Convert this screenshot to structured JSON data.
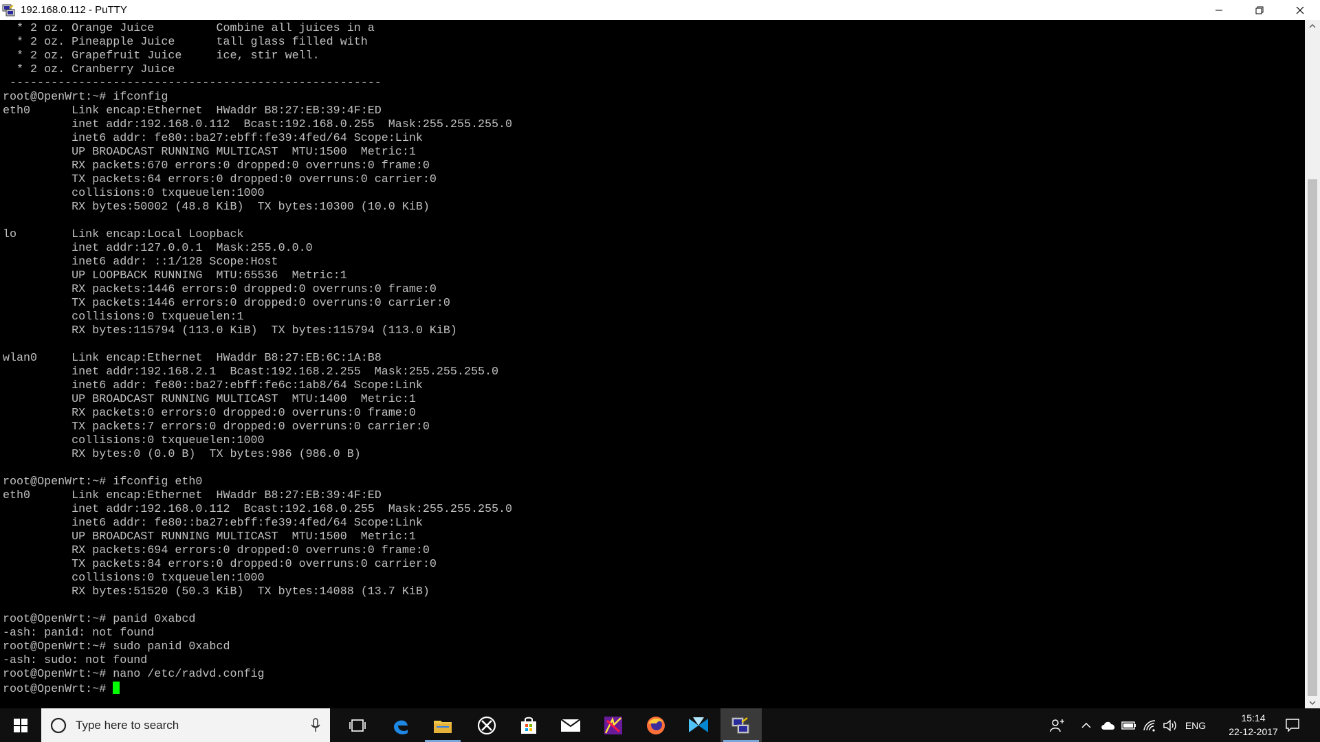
{
  "window": {
    "title": "192.168.0.112 - PuTTY",
    "minimize_icon": "minimize-icon",
    "maximize_icon": "restore-icon",
    "close_icon": "close-icon"
  },
  "terminal": {
    "lines": [
      "  * 2 oz. Orange Juice         Combine all juices in a",
      "  * 2 oz. Pineapple Juice      tall glass filled with",
      "  * 2 oz. Grapefruit Juice     ice, stir well.",
      "  * 2 oz. Cranberry Juice",
      " ------------------------------------------------------",
      "root@OpenWrt:~# ifconfig",
      "eth0      Link encap:Ethernet  HWaddr B8:27:EB:39:4F:ED",
      "          inet addr:192.168.0.112  Bcast:192.168.0.255  Mask:255.255.255.0",
      "          inet6 addr: fe80::ba27:ebff:fe39:4fed/64 Scope:Link",
      "          UP BROADCAST RUNNING MULTICAST  MTU:1500  Metric:1",
      "          RX packets:670 errors:0 dropped:0 overruns:0 frame:0",
      "          TX packets:64 errors:0 dropped:0 overruns:0 carrier:0",
      "          collisions:0 txqueuelen:1000",
      "          RX bytes:50002 (48.8 KiB)  TX bytes:10300 (10.0 KiB)",
      "",
      "lo        Link encap:Local Loopback",
      "          inet addr:127.0.0.1  Mask:255.0.0.0",
      "          inet6 addr: ::1/128 Scope:Host",
      "          UP LOOPBACK RUNNING  MTU:65536  Metric:1",
      "          RX packets:1446 errors:0 dropped:0 overruns:0 frame:0",
      "          TX packets:1446 errors:0 dropped:0 overruns:0 carrier:0",
      "          collisions:0 txqueuelen:1",
      "          RX bytes:115794 (113.0 KiB)  TX bytes:115794 (113.0 KiB)",
      "",
      "wlan0     Link encap:Ethernet  HWaddr B8:27:EB:6C:1A:B8",
      "          inet addr:192.168.2.1  Bcast:192.168.2.255  Mask:255.255.255.0",
      "          inet6 addr: fe80::ba27:ebff:fe6c:1ab8/64 Scope:Link",
      "          UP BROADCAST RUNNING MULTICAST  MTU:1400  Metric:1",
      "          RX packets:0 errors:0 dropped:0 overruns:0 frame:0",
      "          TX packets:7 errors:0 dropped:0 overruns:0 carrier:0",
      "          collisions:0 txqueuelen:1000",
      "          RX bytes:0 (0.0 B)  TX bytes:986 (986.0 B)",
      "",
      "root@OpenWrt:~# ifconfig eth0",
      "eth0      Link encap:Ethernet  HWaddr B8:27:EB:39:4F:ED",
      "          inet addr:192.168.0.112  Bcast:192.168.0.255  Mask:255.255.255.0",
      "          inet6 addr: fe80::ba27:ebff:fe39:4fed/64 Scope:Link",
      "          UP BROADCAST RUNNING MULTICAST  MTU:1500  Metric:1",
      "          RX packets:694 errors:0 dropped:0 overruns:0 frame:0",
      "          TX packets:84 errors:0 dropped:0 overruns:0 carrier:0",
      "          collisions:0 txqueuelen:1000",
      "          RX bytes:51520 (50.3 KiB)  TX bytes:14088 (13.7 KiB)",
      "",
      "root@OpenWrt:~# panid 0xabcd",
      "-ash: panid: not found",
      "root@OpenWrt:~# sudo panid 0xabcd",
      "-ash: sudo: not found",
      "root@OpenWrt:~# nano /etc/radvd.config"
    ],
    "prompt": "root@OpenWrt:~# ",
    "cursor_color": "#00ff00",
    "text_color": "#c0c0c0"
  },
  "taskbar": {
    "search_placeholder": "Type here to search",
    "apps": [
      {
        "name": "task-view-icon"
      },
      {
        "name": "edge-icon"
      },
      {
        "name": "file-explorer-icon"
      },
      {
        "name": "xbox-icon"
      },
      {
        "name": "store-icon"
      },
      {
        "name": "mail-icon"
      },
      {
        "name": "app-icon"
      },
      {
        "name": "firefox-icon"
      },
      {
        "name": "app-icon"
      },
      {
        "name": "putty-icon"
      }
    ],
    "language": "ENG",
    "time": "15:14",
    "date": "22-12-2017"
  }
}
